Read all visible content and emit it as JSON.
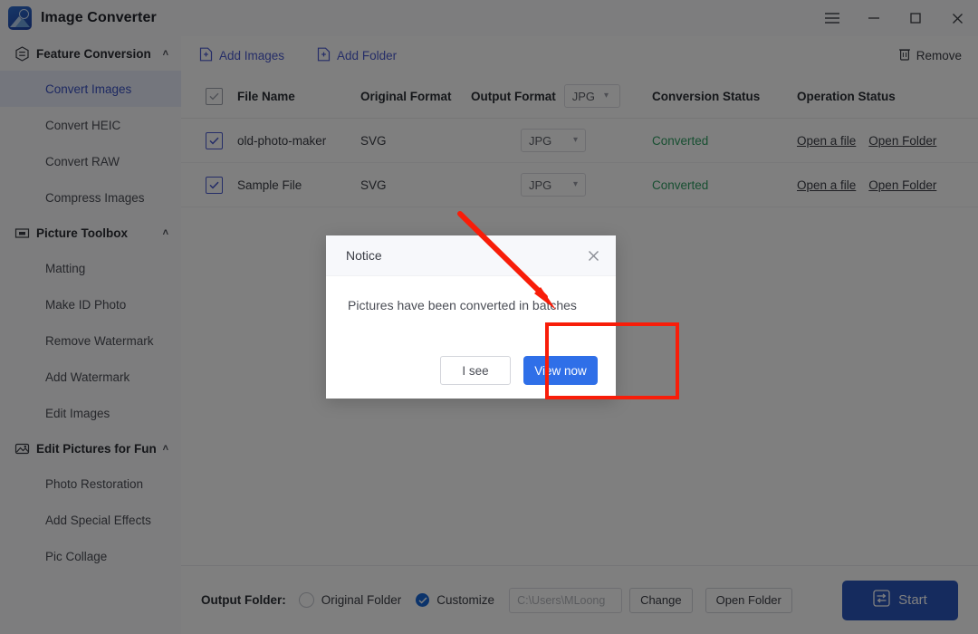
{
  "window": {
    "title": "Image Converter",
    "logo_icon": "image-converter-logo",
    "controls": [
      {
        "name": "menu-button",
        "icon": "hamburger-icon"
      },
      {
        "name": "minimize-button",
        "icon": "minimize-icon"
      },
      {
        "name": "maximize-button",
        "icon": "maximize-icon"
      },
      {
        "name": "close-button",
        "icon": "close-icon"
      }
    ]
  },
  "sidebar": {
    "groups": [
      {
        "label": "Feature Conversion",
        "icon": "conversion-icon",
        "chevron": "˄",
        "items": [
          {
            "label": "Convert Images",
            "active": true
          },
          {
            "label": "Convert HEIC",
            "active": false
          },
          {
            "label": "Convert RAW",
            "active": false
          },
          {
            "label": "Compress Images",
            "active": false
          }
        ]
      },
      {
        "label": "Picture Toolbox",
        "icon": "toolbox-icon",
        "chevron": "˄",
        "items": [
          {
            "label": "Matting",
            "active": false
          },
          {
            "label": "Make ID Photo",
            "active": false
          },
          {
            "label": "Remove Watermark",
            "active": false
          },
          {
            "label": "Add Watermark",
            "active": false
          },
          {
            "label": "Edit Images",
            "active": false
          }
        ]
      },
      {
        "label": "Edit Pictures for Fun",
        "icon": "fun-edit-icon",
        "chevron": "˄",
        "items": [
          {
            "label": "Photo Restoration",
            "active": false
          },
          {
            "label": "Add Special Effects",
            "active": false
          },
          {
            "label": "Pic Collage",
            "active": false
          }
        ]
      }
    ]
  },
  "toolbar": {
    "add_images_label": "Add Images",
    "add_images_icon": "add-file-icon",
    "add_folder_label": "Add Folder",
    "add_folder_icon": "add-folder-icon",
    "remove_label": "Remove",
    "remove_icon": "trash-icon"
  },
  "table": {
    "headers": {
      "file_name": "File Name",
      "original_format": "Original Format",
      "output_format": "Output Format",
      "conversion_status": "Conversion Status",
      "operation_status": "Operation Status"
    },
    "header_output_format_value": "JPG",
    "header_select_all_checked": true,
    "rows": [
      {
        "checked": true,
        "file_name": "old-photo-maker",
        "original_format": "SVG",
        "output_format": "JPG",
        "conversion_status": "Converted",
        "open_file_label": "Open a file",
        "open_folder_label": "Open Folder"
      },
      {
        "checked": true,
        "file_name": "Sample File",
        "original_format": "SVG",
        "output_format": "JPG",
        "conversion_status": "Converted",
        "open_file_label": "Open a file",
        "open_folder_label": "Open Folder"
      }
    ]
  },
  "bottom": {
    "output_folder_label": "Output Folder:",
    "original_folder_label": "Original Folder",
    "original_folder_selected": false,
    "customize_label": "Customize",
    "customize_selected": true,
    "path_value": "C:\\Users\\MLoong",
    "change_label": "Change",
    "open_folder_label": "Open Folder",
    "start_label": "Start",
    "start_icon": "convert-arrows-icon"
  },
  "dialog": {
    "title": "Notice",
    "close_icon": "close-icon",
    "message": "Pictures have been converted in batches",
    "secondary_label": "I see",
    "primary_label": "View now"
  },
  "annotations": {
    "highlight_color": "#f81d09",
    "arrow_color": "#f81d09",
    "highlight_target": "view-now-button",
    "arrow_target": "dialog-message"
  },
  "colors": {
    "accent_blue": "#2f6fe8",
    "sidebar_active": "#3b52c4",
    "status_converted": "#2f9e63",
    "start_button": "#2b57bd",
    "link": "#3a3d45"
  }
}
